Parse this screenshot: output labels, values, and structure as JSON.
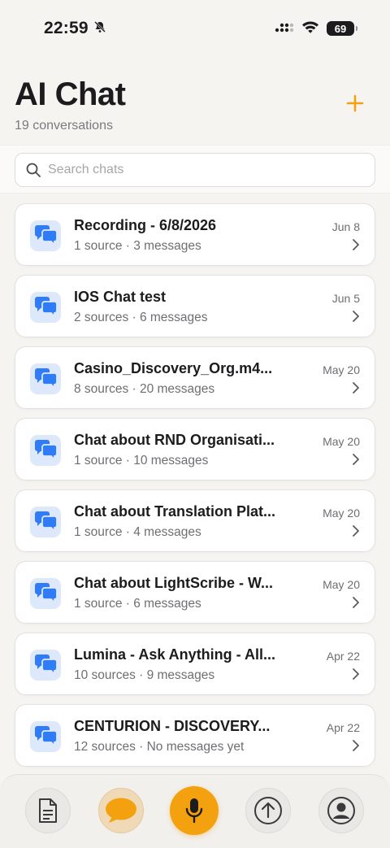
{
  "status": {
    "time": "22:59",
    "battery": "69",
    "icons": [
      "bell-slash-icon",
      "cellular-signal-icon",
      "wifi-icon",
      "battery-icon"
    ]
  },
  "header": {
    "title": "AI Chat",
    "subtitle": "19 conversations",
    "add_icon": "plus-icon"
  },
  "search": {
    "placeholder": "Search chats",
    "value": ""
  },
  "chats": [
    {
      "title": "Recording - 6/8/2026",
      "meta": "1 source · 3 messages",
      "date": "Jun 8"
    },
    {
      "title": "IOS Chat test",
      "meta": "2 sources · 6 messages",
      "date": "Jun 5"
    },
    {
      "title": "Casino_Discovery_Org.m4...",
      "meta": "8 sources · 20 messages",
      "date": "May 20"
    },
    {
      "title": "Chat about RND Organisati...",
      "meta": "1 source · 10 messages",
      "date": "May 20"
    },
    {
      "title": "Chat about Translation Plat...",
      "meta": "1 source · 4 messages",
      "date": "May 20"
    },
    {
      "title": "Chat about LightScribe - W...",
      "meta": "1 source · 6 messages",
      "date": "May 20"
    },
    {
      "title": "Lumina - Ask Anything - All...",
      "meta": "10 sources · 9 messages",
      "date": "Apr 22"
    },
    {
      "title": "CENTURION - DISCOVERY...",
      "meta": "12 sources · No messages yet",
      "date": "Apr 22"
    }
  ],
  "tabs": [
    "document-icon",
    "chat-bubble-icon",
    "microphone-icon",
    "upload-arrow-icon",
    "profile-icon"
  ],
  "colors": {
    "accent": "#f4a10f",
    "chat_icon_blue": "#2f7cf6",
    "chat_icon_bg": "#dde9fb",
    "background": "#f5f4f1"
  }
}
